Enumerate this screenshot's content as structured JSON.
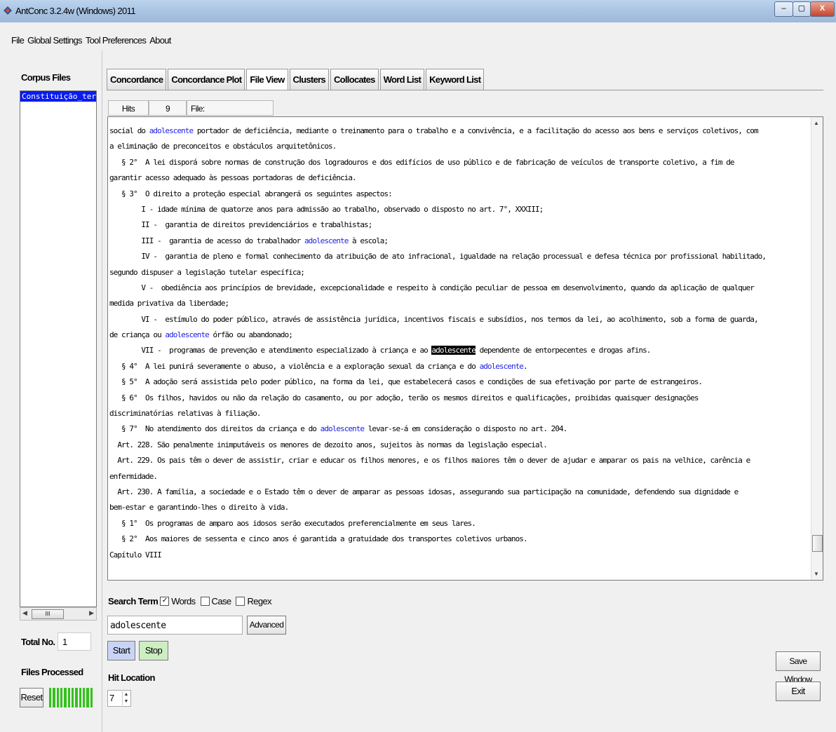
{
  "window": {
    "title": "AntConc 3.2.4w (Windows) 2011",
    "minimize_label": "–",
    "maximize_label": "▢",
    "close_label": "X"
  },
  "menu": [
    "File",
    "Global Settings",
    "Tool Preferences",
    "About"
  ],
  "left_panel": {
    "corpus_files_label": "Corpus Files",
    "corpus_files": [
      "Constituição_termisul.txt"
    ],
    "scroll_thumb_label": "III",
    "total_no_label": "Total No.",
    "total_no_value": "1",
    "files_processed_label": "Files Processed",
    "reset_label": "Reset",
    "progress_fraction": 1.0
  },
  "tabs": [
    "Concordance",
    "Concordance Plot",
    "File View",
    "Clusters",
    "Collocates",
    "Word List",
    "Keyword List"
  ],
  "active_tab": "File View",
  "hits_bar": {
    "hits_label": "Hits",
    "hits_value": "9",
    "file_label": "File: Constituição_termisul.txt"
  },
  "text_lines": [
    {
      "parts": [
        {
          "t": "social do "
        },
        {
          "t": "adolescente",
          "kw": 1
        },
        {
          "t": " portador de deficiência, mediante o treinamento para o trabalho e a convivência, e a facilitação do acesso aos bens e serviços coletivos, com"
        }
      ]
    },
    {
      "parts": [
        {
          "t": "a eliminação de preconceitos e obstáculos arquitetônicos."
        }
      ]
    },
    {
      "parts": [
        {
          "t": "   § 2°  A lei disporá sobre normas de construção dos logradouros e dos edifícios de uso público e de fabricação de veículos de transporte coletivo, a fim de"
        }
      ]
    },
    {
      "parts": [
        {
          "t": "garantir acesso adequado às pessoas portadoras de deficiência."
        }
      ]
    },
    {
      "parts": [
        {
          "t": "   § 3°  O direito a proteção especial abrangerá os seguintes aspectos:"
        }
      ]
    },
    {
      "parts": [
        {
          "t": "        I - idade mínima de quatorze anos para admissão ao trabalho, observado o disposto no art. 7°, XXXIII;"
        }
      ]
    },
    {
      "parts": [
        {
          "t": "        II -  garantia de direitos previdenciários e trabalhistas;"
        }
      ]
    },
    {
      "parts": [
        {
          "t": "        III -  garantia de acesso do trabalhador "
        },
        {
          "t": "adolescente",
          "kw": 1
        },
        {
          "t": " à escola;"
        }
      ]
    },
    {
      "parts": [
        {
          "t": "        IV -  garantia de pleno e formal conhecimento da atribuição de ato infracional, igualdade na relação processual e defesa técnica por profissional habilitado,"
        }
      ]
    },
    {
      "parts": [
        {
          "t": "segundo dispuser a legislação tutelar específica;"
        }
      ]
    },
    {
      "parts": [
        {
          "t": "        V -  obediência aos princípios de brevidade, excepcionalidade e respeito à condição peculiar de pessoa em desenvolvimento, quando da aplicação de qualquer"
        }
      ]
    },
    {
      "parts": [
        {
          "t": "medida privativa da liberdade;"
        }
      ]
    },
    {
      "parts": [
        {
          "t": "        VI -  estímulo do poder público, através de assistência jurídica, incentivos fiscais e subsídios, nos termos da lei, ao acolhimento, sob a forma de guarda,"
        }
      ]
    },
    {
      "parts": [
        {
          "t": "de criança ou "
        },
        {
          "t": "adolescente",
          "kw": 1
        },
        {
          "t": " órfão ou abandonado;"
        }
      ]
    },
    {
      "parts": [
        {
          "t": "        VII -  programas de prevenção e atendimento especializado à criança e ao "
        },
        {
          "t": "adolescente",
          "kw": 2
        },
        {
          "t": " dependente de entorpecentes e drogas afins."
        }
      ]
    },
    {
      "parts": [
        {
          "t": "   § 4°  A lei punirá severamente o abuso, a violência e a exploração sexual da criança e do "
        },
        {
          "t": "adolescente",
          "kw": 1
        },
        {
          "t": "."
        }
      ]
    },
    {
      "parts": [
        {
          "t": "   § 5°  A adoção será assistida pelo poder público, na forma da lei, que estabelecerá casos e condições de sua efetivação por parte de estrangeiros."
        }
      ]
    },
    {
      "parts": [
        {
          "t": "   § 6°  Os filhos, havidos ou não da relação do casamento, ou por adoção, terão os mesmos direitos e qualificações, proibidas quaisquer designações"
        }
      ]
    },
    {
      "parts": [
        {
          "t": "discriminatórias relativas à filiação."
        }
      ]
    },
    {
      "parts": [
        {
          "t": "   § 7°  No atendimento dos direitos da criança e do "
        },
        {
          "t": "adolescente",
          "kw": 1
        },
        {
          "t": " levar-se-á em consideração o disposto no art. 204."
        }
      ]
    },
    {
      "parts": [
        {
          "t": "  Art. 228. São penalmente inimputáveis os menores de dezoito anos, sujeitos às normas da legislação especial."
        }
      ]
    },
    {
      "parts": [
        {
          "t": "  Art. 229. Os pais têm o dever de assistir, criar e educar os filhos menores, e os filhos maiores têm o dever de ajudar e amparar os pais na velhice, carência e"
        }
      ]
    },
    {
      "parts": [
        {
          "t": "enfermidade."
        }
      ]
    },
    {
      "parts": [
        {
          "t": "  Art. 230. A família, a sociedade e o Estado têm o dever de amparar as pessoas idosas, assegurando sua participação na comunidade, defendendo sua dignidade e"
        }
      ]
    },
    {
      "parts": [
        {
          "t": "bem-estar e garantindo-lhes o direito à vida."
        }
      ]
    },
    {
      "parts": [
        {
          "t": "   § 1°  Os programas de amparo aos idosos serão executados preferencialmente em seus lares."
        }
      ]
    },
    {
      "parts": [
        {
          "t": "   § 2°  Aos maiores de sessenta e cinco anos é garantida a gratuidade dos transportes coletivos urbanos."
        }
      ]
    },
    {
      "parts": [
        {
          "t": "Capítulo VIII"
        }
      ]
    }
  ],
  "search": {
    "label": "Search Term",
    "words_label": "Words",
    "words_checked": true,
    "case_label": "Case",
    "case_checked": false,
    "regex_label": "Regex",
    "regex_checked": false,
    "value": "adolescente",
    "advanced_label": "Advanced",
    "start_label": "Start",
    "stop_label": "Stop",
    "hit_location_label": "Hit Location",
    "hit_location_value": "7"
  },
  "right_buttons": {
    "save_window_label": "Save Window",
    "exit_label": "Exit"
  },
  "colors": {
    "keyword": "#1e22e6",
    "selected_file": "#0a1cf0",
    "start_button": "#c9d4f5",
    "stop_button": "#cdeec1",
    "progress": "#34c21b"
  }
}
